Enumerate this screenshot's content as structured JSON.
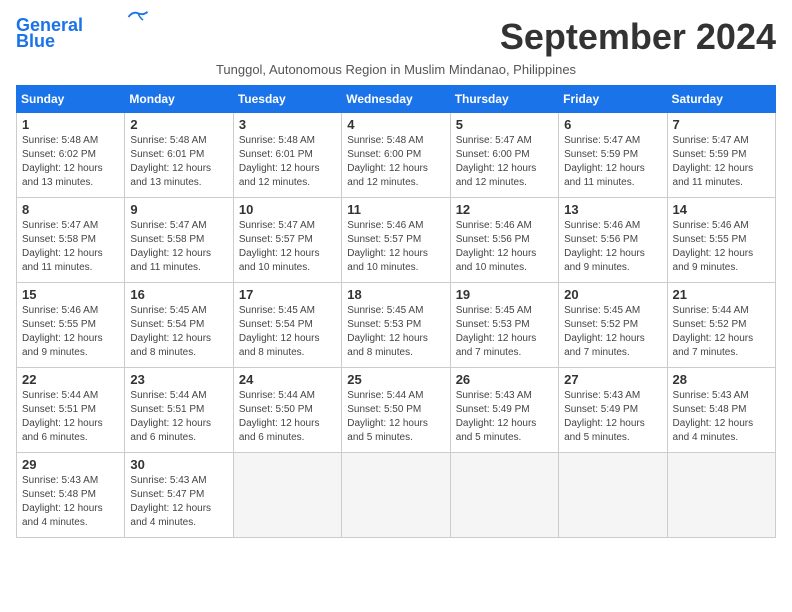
{
  "header": {
    "logo_line1": "General",
    "logo_line2": "Blue",
    "month_title": "September 2024",
    "subtitle": "Tunggol, Autonomous Region in Muslim Mindanao, Philippines"
  },
  "weekdays": [
    "Sunday",
    "Monday",
    "Tuesday",
    "Wednesday",
    "Thursday",
    "Friday",
    "Saturday"
  ],
  "weeks": [
    [
      {
        "day": "1",
        "sunrise": "5:48 AM",
        "sunset": "6:02 PM",
        "daylight": "12 hours and 13 minutes."
      },
      {
        "day": "2",
        "sunrise": "5:48 AM",
        "sunset": "6:01 PM",
        "daylight": "12 hours and 13 minutes."
      },
      {
        "day": "3",
        "sunrise": "5:48 AM",
        "sunset": "6:01 PM",
        "daylight": "12 hours and 12 minutes."
      },
      {
        "day": "4",
        "sunrise": "5:48 AM",
        "sunset": "6:00 PM",
        "daylight": "12 hours and 12 minutes."
      },
      {
        "day": "5",
        "sunrise": "5:47 AM",
        "sunset": "6:00 PM",
        "daylight": "12 hours and 12 minutes."
      },
      {
        "day": "6",
        "sunrise": "5:47 AM",
        "sunset": "5:59 PM",
        "daylight": "12 hours and 11 minutes."
      },
      {
        "day": "7",
        "sunrise": "5:47 AM",
        "sunset": "5:59 PM",
        "daylight": "12 hours and 11 minutes."
      }
    ],
    [
      {
        "day": "8",
        "sunrise": "5:47 AM",
        "sunset": "5:58 PM",
        "daylight": "12 hours and 11 minutes."
      },
      {
        "day": "9",
        "sunrise": "5:47 AM",
        "sunset": "5:58 PM",
        "daylight": "12 hours and 11 minutes."
      },
      {
        "day": "10",
        "sunrise": "5:47 AM",
        "sunset": "5:57 PM",
        "daylight": "12 hours and 10 minutes."
      },
      {
        "day": "11",
        "sunrise": "5:46 AM",
        "sunset": "5:57 PM",
        "daylight": "12 hours and 10 minutes."
      },
      {
        "day": "12",
        "sunrise": "5:46 AM",
        "sunset": "5:56 PM",
        "daylight": "12 hours and 10 minutes."
      },
      {
        "day": "13",
        "sunrise": "5:46 AM",
        "sunset": "5:56 PM",
        "daylight": "12 hours and 9 minutes."
      },
      {
        "day": "14",
        "sunrise": "5:46 AM",
        "sunset": "5:55 PM",
        "daylight": "12 hours and 9 minutes."
      }
    ],
    [
      {
        "day": "15",
        "sunrise": "5:46 AM",
        "sunset": "5:55 PM",
        "daylight": "12 hours and 9 minutes."
      },
      {
        "day": "16",
        "sunrise": "5:45 AM",
        "sunset": "5:54 PM",
        "daylight": "12 hours and 8 minutes."
      },
      {
        "day": "17",
        "sunrise": "5:45 AM",
        "sunset": "5:54 PM",
        "daylight": "12 hours and 8 minutes."
      },
      {
        "day": "18",
        "sunrise": "5:45 AM",
        "sunset": "5:53 PM",
        "daylight": "12 hours and 8 minutes."
      },
      {
        "day": "19",
        "sunrise": "5:45 AM",
        "sunset": "5:53 PM",
        "daylight": "12 hours and 7 minutes."
      },
      {
        "day": "20",
        "sunrise": "5:45 AM",
        "sunset": "5:52 PM",
        "daylight": "12 hours and 7 minutes."
      },
      {
        "day": "21",
        "sunrise": "5:44 AM",
        "sunset": "5:52 PM",
        "daylight": "12 hours and 7 minutes."
      }
    ],
    [
      {
        "day": "22",
        "sunrise": "5:44 AM",
        "sunset": "5:51 PM",
        "daylight": "12 hours and 6 minutes."
      },
      {
        "day": "23",
        "sunrise": "5:44 AM",
        "sunset": "5:51 PM",
        "daylight": "12 hours and 6 minutes."
      },
      {
        "day": "24",
        "sunrise": "5:44 AM",
        "sunset": "5:50 PM",
        "daylight": "12 hours and 6 minutes."
      },
      {
        "day": "25",
        "sunrise": "5:44 AM",
        "sunset": "5:50 PM",
        "daylight": "12 hours and 5 minutes."
      },
      {
        "day": "26",
        "sunrise": "5:43 AM",
        "sunset": "5:49 PM",
        "daylight": "12 hours and 5 minutes."
      },
      {
        "day": "27",
        "sunrise": "5:43 AM",
        "sunset": "5:49 PM",
        "daylight": "12 hours and 5 minutes."
      },
      {
        "day": "28",
        "sunrise": "5:43 AM",
        "sunset": "5:48 PM",
        "daylight": "12 hours and 4 minutes."
      }
    ],
    [
      {
        "day": "29",
        "sunrise": "5:43 AM",
        "sunset": "5:48 PM",
        "daylight": "12 hours and 4 minutes."
      },
      {
        "day": "30",
        "sunrise": "5:43 AM",
        "sunset": "5:47 PM",
        "daylight": "12 hours and 4 minutes."
      },
      null,
      null,
      null,
      null,
      null
    ]
  ]
}
